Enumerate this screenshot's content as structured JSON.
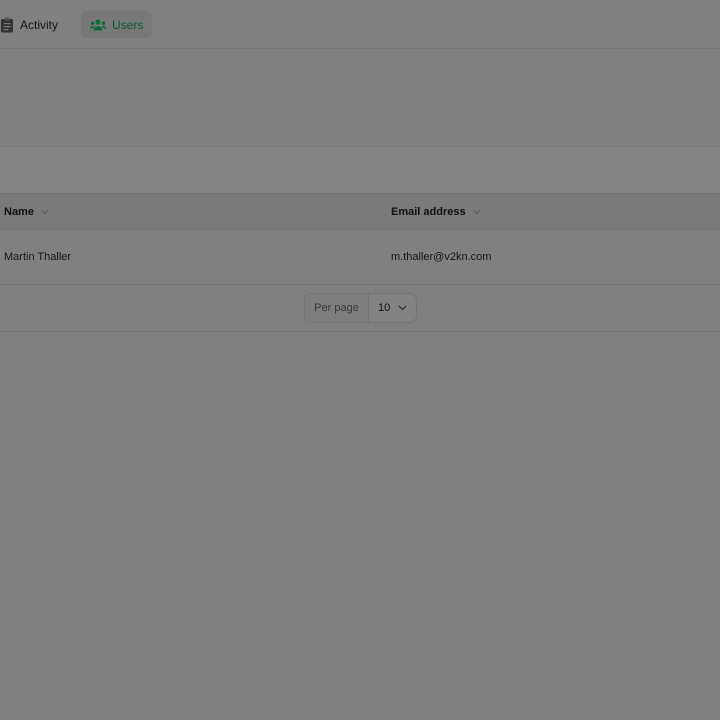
{
  "nav": {
    "items": [
      {
        "label": "Activity",
        "icon": "clipboard-icon",
        "active": false
      },
      {
        "label": "Users",
        "icon": "users-icon",
        "active": true
      }
    ]
  },
  "table": {
    "columns": [
      {
        "label": "Name",
        "sortable": true
      },
      {
        "label": "Email address",
        "sortable": true
      }
    ],
    "rows": [
      {
        "name": "Martin Thaller",
        "email": "m.thaller@v2kn.com"
      }
    ]
  },
  "pagination": {
    "per_page_label": "Per page",
    "per_page_value": "10"
  },
  "colors": {
    "accent": "#0a5b33",
    "overlay": "#808080"
  }
}
